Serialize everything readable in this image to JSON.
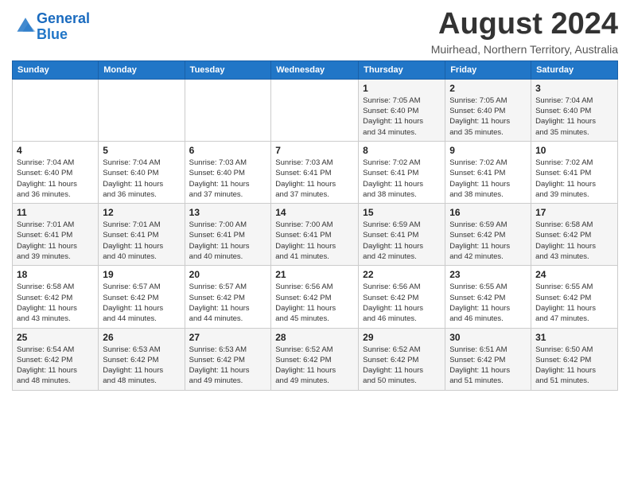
{
  "header": {
    "logo_line1": "General",
    "logo_line2": "Blue",
    "month_title": "August 2024",
    "location": "Muirhead, Northern Territory, Australia"
  },
  "days_of_week": [
    "Sunday",
    "Monday",
    "Tuesday",
    "Wednesday",
    "Thursday",
    "Friday",
    "Saturday"
  ],
  "weeks": [
    [
      {
        "day": "",
        "info": ""
      },
      {
        "day": "",
        "info": ""
      },
      {
        "day": "",
        "info": ""
      },
      {
        "day": "",
        "info": ""
      },
      {
        "day": "1",
        "info": "Sunrise: 7:05 AM\nSunset: 6:40 PM\nDaylight: 11 hours\nand 34 minutes."
      },
      {
        "day": "2",
        "info": "Sunrise: 7:05 AM\nSunset: 6:40 PM\nDaylight: 11 hours\nand 35 minutes."
      },
      {
        "day": "3",
        "info": "Sunrise: 7:04 AM\nSunset: 6:40 PM\nDaylight: 11 hours\nand 35 minutes."
      }
    ],
    [
      {
        "day": "4",
        "info": "Sunrise: 7:04 AM\nSunset: 6:40 PM\nDaylight: 11 hours\nand 36 minutes."
      },
      {
        "day": "5",
        "info": "Sunrise: 7:04 AM\nSunset: 6:40 PM\nDaylight: 11 hours\nand 36 minutes."
      },
      {
        "day": "6",
        "info": "Sunrise: 7:03 AM\nSunset: 6:40 PM\nDaylight: 11 hours\nand 37 minutes."
      },
      {
        "day": "7",
        "info": "Sunrise: 7:03 AM\nSunset: 6:41 PM\nDaylight: 11 hours\nand 37 minutes."
      },
      {
        "day": "8",
        "info": "Sunrise: 7:02 AM\nSunset: 6:41 PM\nDaylight: 11 hours\nand 38 minutes."
      },
      {
        "day": "9",
        "info": "Sunrise: 7:02 AM\nSunset: 6:41 PM\nDaylight: 11 hours\nand 38 minutes."
      },
      {
        "day": "10",
        "info": "Sunrise: 7:02 AM\nSunset: 6:41 PM\nDaylight: 11 hours\nand 39 minutes."
      }
    ],
    [
      {
        "day": "11",
        "info": "Sunrise: 7:01 AM\nSunset: 6:41 PM\nDaylight: 11 hours\nand 39 minutes."
      },
      {
        "day": "12",
        "info": "Sunrise: 7:01 AM\nSunset: 6:41 PM\nDaylight: 11 hours\nand 40 minutes."
      },
      {
        "day": "13",
        "info": "Sunrise: 7:00 AM\nSunset: 6:41 PM\nDaylight: 11 hours\nand 40 minutes."
      },
      {
        "day": "14",
        "info": "Sunrise: 7:00 AM\nSunset: 6:41 PM\nDaylight: 11 hours\nand 41 minutes."
      },
      {
        "day": "15",
        "info": "Sunrise: 6:59 AM\nSunset: 6:41 PM\nDaylight: 11 hours\nand 42 minutes."
      },
      {
        "day": "16",
        "info": "Sunrise: 6:59 AM\nSunset: 6:42 PM\nDaylight: 11 hours\nand 42 minutes."
      },
      {
        "day": "17",
        "info": "Sunrise: 6:58 AM\nSunset: 6:42 PM\nDaylight: 11 hours\nand 43 minutes."
      }
    ],
    [
      {
        "day": "18",
        "info": "Sunrise: 6:58 AM\nSunset: 6:42 PM\nDaylight: 11 hours\nand 43 minutes."
      },
      {
        "day": "19",
        "info": "Sunrise: 6:57 AM\nSunset: 6:42 PM\nDaylight: 11 hours\nand 44 minutes."
      },
      {
        "day": "20",
        "info": "Sunrise: 6:57 AM\nSunset: 6:42 PM\nDaylight: 11 hours\nand 44 minutes."
      },
      {
        "day": "21",
        "info": "Sunrise: 6:56 AM\nSunset: 6:42 PM\nDaylight: 11 hours\nand 45 minutes."
      },
      {
        "day": "22",
        "info": "Sunrise: 6:56 AM\nSunset: 6:42 PM\nDaylight: 11 hours\nand 46 minutes."
      },
      {
        "day": "23",
        "info": "Sunrise: 6:55 AM\nSunset: 6:42 PM\nDaylight: 11 hours\nand 46 minutes."
      },
      {
        "day": "24",
        "info": "Sunrise: 6:55 AM\nSunset: 6:42 PM\nDaylight: 11 hours\nand 47 minutes."
      }
    ],
    [
      {
        "day": "25",
        "info": "Sunrise: 6:54 AM\nSunset: 6:42 PM\nDaylight: 11 hours\nand 48 minutes."
      },
      {
        "day": "26",
        "info": "Sunrise: 6:53 AM\nSunset: 6:42 PM\nDaylight: 11 hours\nand 48 minutes."
      },
      {
        "day": "27",
        "info": "Sunrise: 6:53 AM\nSunset: 6:42 PM\nDaylight: 11 hours\nand 49 minutes."
      },
      {
        "day": "28",
        "info": "Sunrise: 6:52 AM\nSunset: 6:42 PM\nDaylight: 11 hours\nand 49 minutes."
      },
      {
        "day": "29",
        "info": "Sunrise: 6:52 AM\nSunset: 6:42 PM\nDaylight: 11 hours\nand 50 minutes."
      },
      {
        "day": "30",
        "info": "Sunrise: 6:51 AM\nSunset: 6:42 PM\nDaylight: 11 hours\nand 51 minutes."
      },
      {
        "day": "31",
        "info": "Sunrise: 6:50 AM\nSunset: 6:42 PM\nDaylight: 11 hours\nand 51 minutes."
      }
    ]
  ]
}
